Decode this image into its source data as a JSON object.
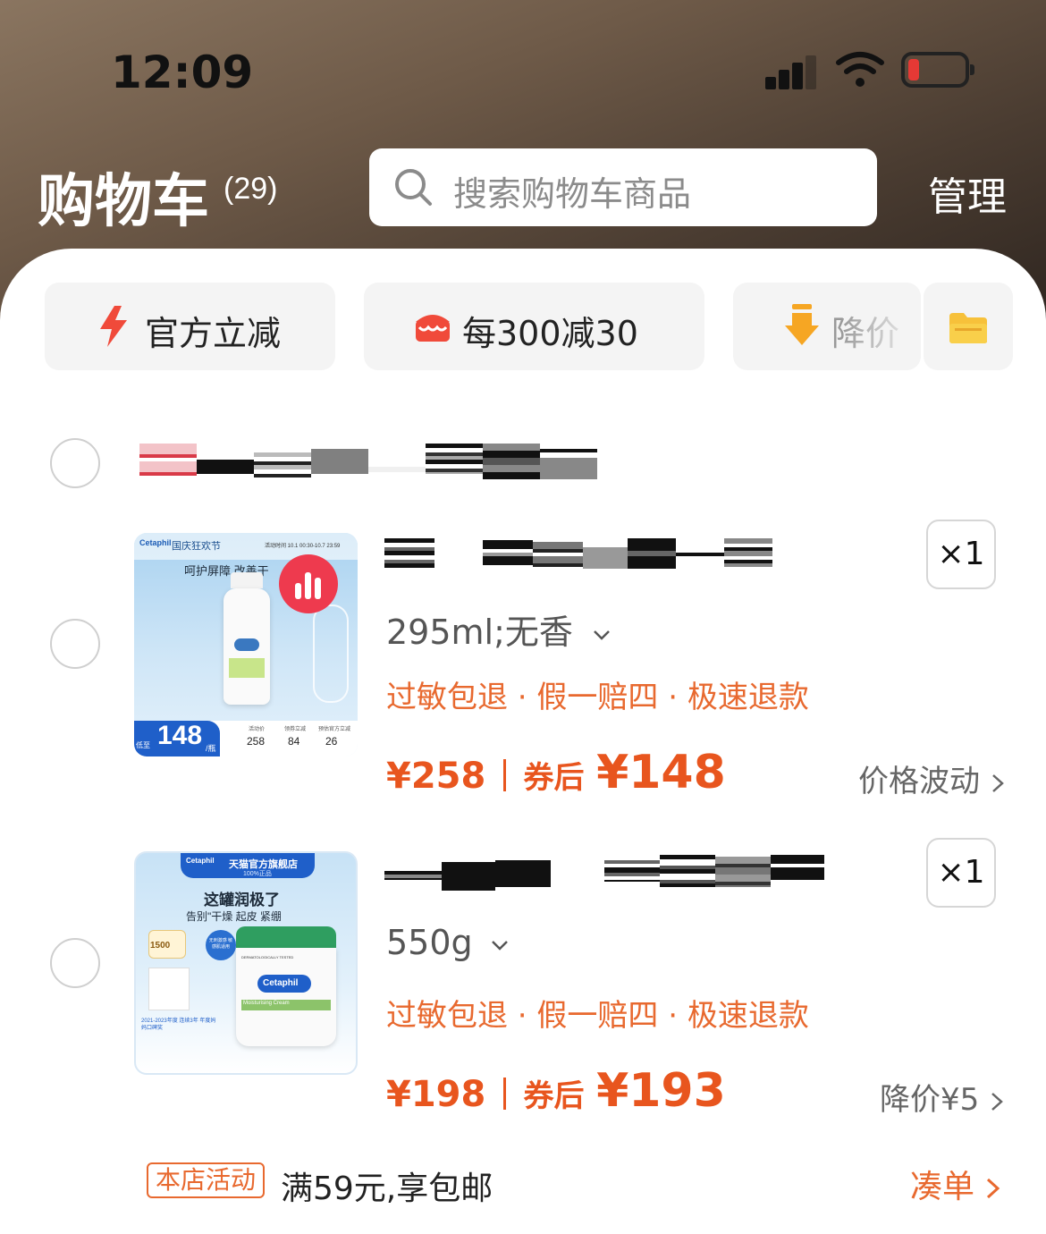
{
  "status_bar": {
    "time": "12:09"
  },
  "header": {
    "title": "购物车",
    "count": "(29)",
    "search_placeholder": "搜索购物车商品",
    "manage_label": "管理"
  },
  "filters": [
    {
      "label": "官方立减",
      "icon": "lightning-icon"
    },
    {
      "label": "每300减30",
      "icon": "store-icon"
    },
    {
      "label": "降价",
      "icon": "arrow-down-icon"
    },
    {
      "label": "",
      "icon": "folder-icon"
    }
  ],
  "items": [
    {
      "variant": "295ml;无香",
      "tags": "过敏包退 · 假一赔四 · 极速退款",
      "price": "¥258",
      "after_coupon_label": "券后",
      "after_coupon_price": "¥148",
      "quantity": "×1",
      "side_link": "价格波动",
      "image": {
        "brand": "Cetaphil",
        "banner": "国庆狂欢节",
        "headline": "呵护屏障 改善干",
        "price_tag": "148",
        "price_unit": "/瓶",
        "price_prefix": "低至",
        "breakdown": [
          "258",
          "84",
          "26"
        ],
        "breakdown_labels": [
          "活动价",
          "领券立减",
          "预估官方立减"
        ],
        "date": "活动时间 10.1 00:30-10.7 23:59"
      }
    },
    {
      "variant": "550g",
      "tags": "过敏包退 · 假一赔四 · 极速退款",
      "price": "¥198",
      "after_coupon_label": "券后",
      "after_coupon_price": "¥193",
      "quantity": "×1",
      "side_link": "降价¥5",
      "image": {
        "brand": "Cetaphil",
        "banner": "天猫官方旗舰店",
        "sub_banner": "100%正品",
        "headline": "这罐润极了",
        "sub_headline": "告别\"干燥 起皮 紧绷",
        "badge": "1500",
        "seal": "无刺激感 敏感肌适用",
        "award": "2021-2023年度 连续3年 年度妈妈口碑奖",
        "product_name": "Moisturising Cream",
        "product_label": "DERMATOLOGICALLY TESTED"
      }
    }
  ],
  "store_promo": {
    "badge": "本店活动",
    "text": "满59元,享包邮",
    "link": "凑单"
  },
  "colors": {
    "accent": "#e8551e",
    "header_bg": "#5a4a3c"
  }
}
